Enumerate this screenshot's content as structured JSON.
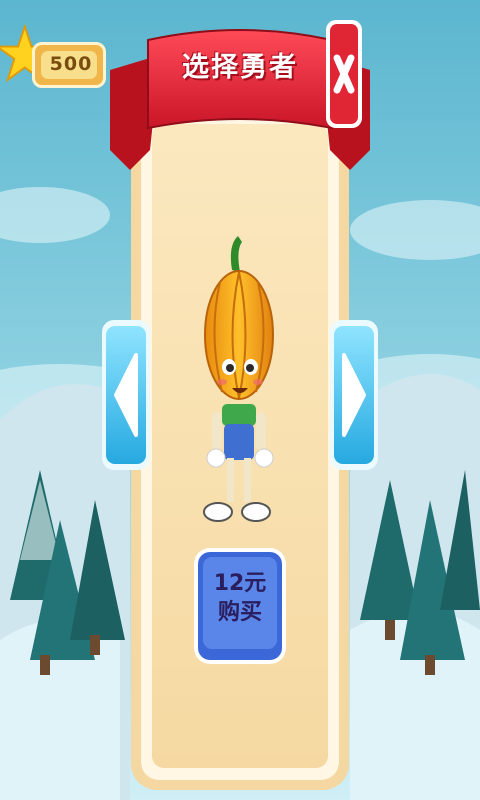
{
  "header": {
    "stars": "500",
    "title": "选择勇者"
  },
  "character": {
    "name": "pumpkin-hero"
  },
  "buy_button": {
    "price": "12元",
    "action": "购买"
  },
  "icons": {
    "star": "star-icon",
    "close": "close-icon",
    "prev": "arrow-left-icon",
    "next": "arrow-right-icon"
  },
  "colors": {
    "sky": "#6bc2d9",
    "ribbon": "#e0283b",
    "panel": "#f9e3b4",
    "button": "#3b67d8",
    "arrow": "#4cc7ee"
  }
}
